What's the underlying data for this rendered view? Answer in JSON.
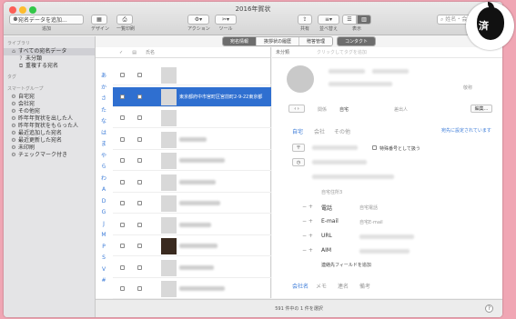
{
  "window": {
    "title": "2016年賀状"
  },
  "toolbar": {
    "add_menu_value": "宛名データを追加...",
    "add_label": "追加",
    "design_label": "デザイン",
    "print_list_label": "一覧印刷",
    "action_label": "アクション",
    "tools_label": "ツール",
    "share_label": "共有",
    "sort_label": "並べ替え",
    "view_label": "表示",
    "search_placeholder": "姓名・会社"
  },
  "sidebar": {
    "library_heading": "ライブラリ",
    "library_items": [
      {
        "label": "すべての宛名データ",
        "selected": true
      },
      {
        "label": "未分類"
      },
      {
        "label": "重複する宛名"
      }
    ],
    "tags_heading": "タグ",
    "smart_heading": "スマートグループ",
    "smart_items": [
      {
        "label": "自宅宛"
      },
      {
        "label": "会社宛"
      },
      {
        "label": "その他宛"
      },
      {
        "label": "昨年年賀状を出した人"
      },
      {
        "label": "昨年年賀状をもらった人"
      },
      {
        "label": "最近追加した宛名"
      },
      {
        "label": "最近更新した宛名"
      },
      {
        "label": "未印刷"
      },
      {
        "label": "チェックマーク付き"
      }
    ]
  },
  "segments": [
    {
      "label": "宛名情報",
      "active": true
    },
    {
      "label": "挨拶状の履歴"
    },
    {
      "label": "贈答管理"
    },
    {
      "label": "コンタクト",
      "active": true
    }
  ],
  "list": {
    "header_name": "氏名",
    "index": [
      "あ",
      "か",
      "さ",
      "た",
      "な",
      "は",
      "ま",
      "や",
      "ら",
      "わ",
      "A",
      "D",
      "G",
      "J",
      "M",
      "P",
      "S",
      "V",
      "#"
    ],
    "selected_address": "東京都府中市宮町区宮前町2-9-22東京都"
  },
  "detail": {
    "category": "未分類",
    "tag_placeholder": "クリックしてタグを追加",
    "honorific_label": "敬称",
    "relation_label": "関係",
    "relation_value": "自宅",
    "sender_label": "差出人",
    "edit_button": "編集...",
    "tab_home": "自宅",
    "tab_company": "会社",
    "tab_other": "その他",
    "set_as_address": "宛先に設定されています",
    "special_number": "特殊番号として扱う",
    "home_address3": "自宅住所3",
    "phone_label": "電話",
    "phone_placeholder": "自宅電話",
    "email_label": "E-mail",
    "email_placeholder": "自宅E-mail",
    "url_label": "URL",
    "aim_label": "AIM",
    "add_contact_field": "連絡先フィールドを追加",
    "bottom_tabs": [
      "会社名",
      "メモ",
      "連名",
      "備考"
    ]
  },
  "status": {
    "text": "591 件中の 1 件を選択"
  },
  "watermark": {
    "text": "済"
  }
}
